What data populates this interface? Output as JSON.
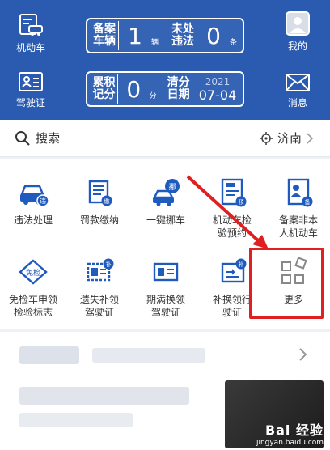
{
  "header": {
    "car_label": "机动车",
    "license_label": "驾驶证",
    "profile_label": "我的",
    "message_label": "消息",
    "card1": {
      "k1": "备案",
      "k2": "车辆",
      "value": "1",
      "unit": "辆",
      "k3": "未处",
      "k4": "违法",
      "value2": "0",
      "unit2": "条"
    },
    "card2": {
      "k1": "累积",
      "k2": "记分",
      "value": "0",
      "unit": "分",
      "k3": "清分",
      "k4": "日期",
      "year": "2021",
      "date": "07-04"
    }
  },
  "search": {
    "label": "搜索",
    "city": "济南"
  },
  "services": [
    {
      "line1": "违法处理",
      "line2": "",
      "icon": "car-violation-icon"
    },
    {
      "line1": "罚款缴纳",
      "line2": "",
      "icon": "fine-payment-icon"
    },
    {
      "line1": "一键挪车",
      "line2": "",
      "icon": "move-car-icon"
    },
    {
      "line1": "机动车检",
      "line2": "验预约",
      "icon": "inspection-booking-icon"
    },
    {
      "line1": "备案非本",
      "line2": "人机动车",
      "icon": "register-vehicle-icon"
    },
    {
      "line1": "免检车申领",
      "line2": "检验标志",
      "icon": "exempt-sign-icon"
    },
    {
      "line1": "遗失补领",
      "line2": "驾驶证",
      "icon": "lost-license-icon"
    },
    {
      "line1": "期满换领",
      "line2": "驾驶证",
      "icon": "renew-license-icon"
    },
    {
      "line1": "补换领行",
      "line2": "驶证",
      "icon": "replace-permit-icon"
    },
    {
      "line1": "更多",
      "line2": "",
      "icon": "more-grid-icon"
    }
  ],
  "watermark": {
    "brand": "Bai 经验",
    "url": "jingyan.baidu.com"
  },
  "colors": {
    "header_blue": "#2a5bb0",
    "icon_blue": "#1f5bbf",
    "highlight_red": "#e02020"
  }
}
